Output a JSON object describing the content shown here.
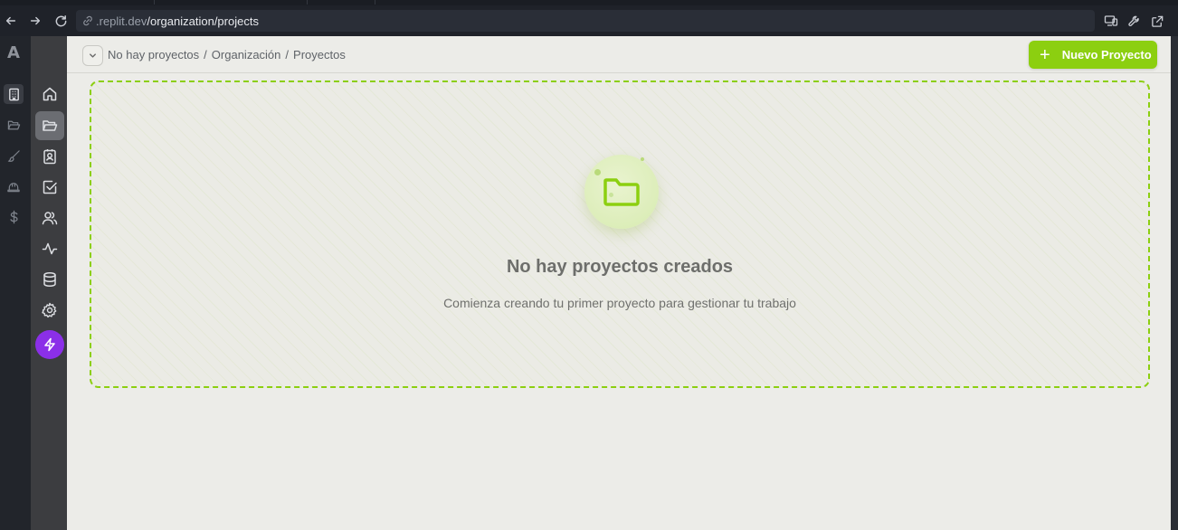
{
  "browser": {
    "url_host": ".replit.dev",
    "url_path": "/organization/projects"
  },
  "rail": {
    "logo_text": "A",
    "icons": [
      "building-icon",
      "folder-open-icon",
      "brush-icon",
      "helmet-icon",
      "dollar-icon"
    ]
  },
  "sidebar": {
    "icons": [
      "home-icon",
      "folder-icon",
      "contact-icon",
      "check-square-icon",
      "users-icon",
      "activity-icon",
      "database-icon",
      "settings-icon",
      "bolt-icon"
    ]
  },
  "breadcrumb": {
    "items": [
      "No hay proyectos",
      "/",
      "Organización",
      "/",
      "Proyectos"
    ]
  },
  "header": {
    "new_button_label": "Nuevo Proyecto"
  },
  "empty_state": {
    "title": "No hay proyectos creados",
    "subtitle": "Comienza creando tu primer proyecto para gestionar tu trabajo"
  },
  "colors": {
    "accent": "#8ccf10",
    "bolt_button": "#8b2fe8",
    "main_bg": "#ecece8"
  }
}
